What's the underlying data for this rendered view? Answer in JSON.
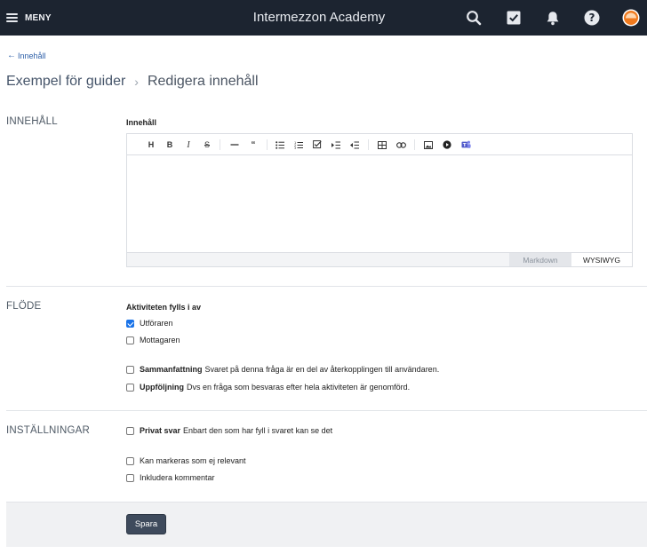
{
  "header": {
    "menu_label": "MENY",
    "app_title": "Intermezzon Academy",
    "icons": [
      "search-icon",
      "tasks-check-icon",
      "bell-icon",
      "help-icon",
      "user-avatar"
    ]
  },
  "breadcrumb": {
    "back_label": "Innehåll",
    "parent": "Exempel för guider",
    "current": "Redigera innehåll"
  },
  "sections": {
    "content": {
      "label": "INNEHÅLL",
      "field_label": "Innehåll",
      "editor_modes": [
        "Markdown",
        "WYSIWYG"
      ],
      "active_mode": "WYSIWYG",
      "toolbar": [
        "heading",
        "bold",
        "italic",
        "strikethrough",
        "horizontal-rule",
        "quote",
        "bullet-list",
        "numbered-list",
        "task-list",
        "indent",
        "outdent",
        "table",
        "link",
        "image",
        "video",
        "teams"
      ]
    },
    "flow": {
      "label": "FLÖDE",
      "subhead": "Aktiviteten fylls i av",
      "performer": "Utföraren",
      "recipient": "Mottagaren",
      "summary_strong": "Sammanfattning",
      "summary_text": "Svaret på denna fråga är en del av återkopplingen till användaren.",
      "followup_strong": "Uppföljning",
      "followup_text": "Dvs en fråga som besvaras efter hela aktiviteten är genomförd."
    },
    "settings": {
      "label": "INSTÄLLNINGAR",
      "private_strong": "Privat svar",
      "private_text": "Enbart den som har fyll i svaret kan se det",
      "irrelevant": "Kan markeras som ej relevant",
      "comment": "Inkludera kommentar"
    }
  },
  "footer": {
    "save_label": "Spara"
  },
  "colors": {
    "topbar": "#1c2430",
    "accent": "#1a73e8",
    "save_button": "#3e4a5c",
    "avatar": "#f07a1e"
  }
}
